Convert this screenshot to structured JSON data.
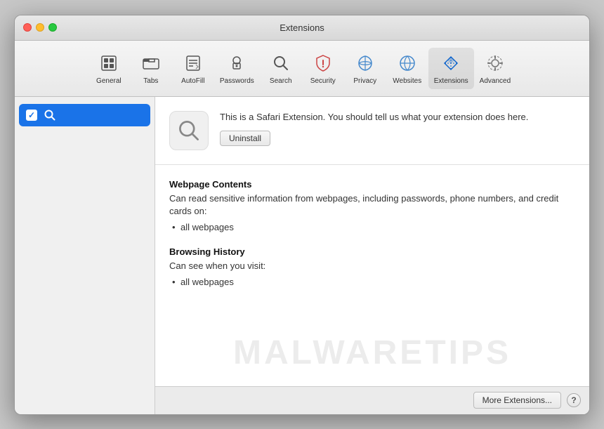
{
  "window": {
    "title": "Extensions"
  },
  "toolbar": {
    "items": [
      {
        "id": "general",
        "label": "General",
        "icon": "general"
      },
      {
        "id": "tabs",
        "label": "Tabs",
        "icon": "tabs"
      },
      {
        "id": "autofill",
        "label": "AutoFill",
        "icon": "autofill"
      },
      {
        "id": "passwords",
        "label": "Passwords",
        "icon": "passwords"
      },
      {
        "id": "search",
        "label": "Search",
        "icon": "search"
      },
      {
        "id": "security",
        "label": "Security",
        "icon": "security"
      },
      {
        "id": "privacy",
        "label": "Privacy",
        "icon": "privacy"
      },
      {
        "id": "websites",
        "label": "Websites",
        "icon": "websites"
      },
      {
        "id": "extensions",
        "label": "Extensions",
        "icon": "extensions",
        "active": true
      },
      {
        "id": "advanced",
        "label": "Advanced",
        "icon": "advanced"
      }
    ]
  },
  "sidebar": {
    "items": [
      {
        "id": "search-ext",
        "label": "",
        "enabled": true,
        "selected": true
      }
    ]
  },
  "extension": {
    "description": "This is a Safari Extension. You should tell us what your extension does here.",
    "uninstall_label": "Uninstall"
  },
  "permissions": {
    "groups": [
      {
        "title": "Webpage Contents",
        "description": "Can read sensitive information from webpages, including passwords, phone numbers, and credit cards on:",
        "items": [
          "all webpages"
        ]
      },
      {
        "title": "Browsing History",
        "description": "Can see when you visit:",
        "items": [
          "all webpages"
        ]
      }
    ]
  },
  "footer": {
    "more_extensions_label": "More Extensions...",
    "help_label": "?"
  },
  "watermark": {
    "text": "MALWARETIPS"
  }
}
